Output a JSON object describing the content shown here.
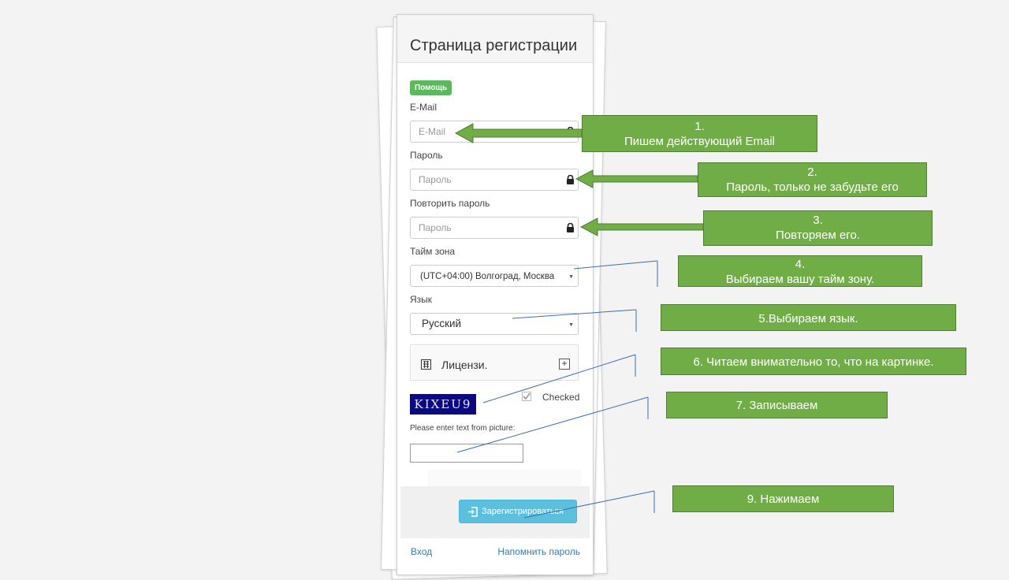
{
  "form": {
    "title": "Страница регистрации",
    "help_badge": "Помощь",
    "email": {
      "label": "E-Mail",
      "placeholder": "E-Mail"
    },
    "password": {
      "label": "Пароль",
      "placeholder": "Пароль"
    },
    "repeat_password": {
      "label": "Повторить пароль",
      "placeholder": "Пароль"
    },
    "timezone": {
      "label": "Тайм зона",
      "value": "(UTC+04:00) Волгоград, Москва"
    },
    "language": {
      "label": "Язык",
      "value": "Русский"
    },
    "license": {
      "label": "Лицензи."
    },
    "captcha": {
      "code": "KIXEU9",
      "checked_label": "Checked",
      "prompt": "Please enter text from picture:"
    },
    "register_button": "Зарегистрироваться",
    "login_link": "Вход",
    "remind_link": "Напомнить пароль"
  },
  "callouts": [
    {
      "line1": "1.",
      "line2": "Пишем действующий  Email"
    },
    {
      "line1": "2.",
      "line2": "Пароль, только не забудьте его"
    },
    {
      "line1": "3.",
      "line2": "Повторяем его."
    },
    {
      "line1": "4.",
      "line2": "Выбираем вашу тайм зону."
    },
    {
      "line1": "5.Выбираем язык."
    },
    {
      "line1": "6. Читаем внимательно то, что на картинке."
    },
    {
      "line1": "7. Записываем"
    },
    {
      "line1": "9. Нажимаем"
    }
  ],
  "colors": {
    "callout_green": "#70ad47",
    "help_badge": "#5cb85c",
    "register_button": "#5bc0de",
    "captcha_bg": "#0a0a7e",
    "link": "#337ab7"
  },
  "icons": [
    "lock-icon",
    "license-icon",
    "plus-icon",
    "enter-icon",
    "arrow-icon"
  ]
}
